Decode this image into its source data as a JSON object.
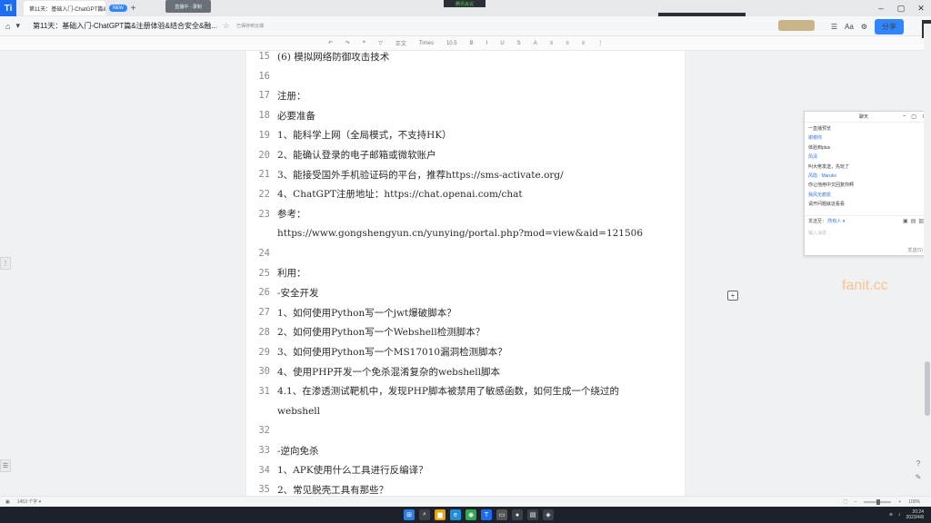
{
  "tabbar": {
    "tab_title": "第11天：基础入门-ChatGPT篇&注册体验&结合安全&融...",
    "tab_badge": "NEW",
    "overlay_text": "直播中 · 录制",
    "meeting_text": "腾讯会议",
    "rec_text": "正在开启 小组会议"
  },
  "titlebar": {
    "doc_title": "第11天：基础入门-ChatGPT篇&注册体验&结合安全&融...",
    "cloud_note": "已保存到云端",
    "share_label": "分享"
  },
  "toolbar": {
    "items": [
      "↶",
      "↷",
      "⌖",
      "▽",
      "正文",
      "Times",
      "10.5",
      "B",
      "I",
      "U",
      "S",
      "A",
      "≡",
      "≡",
      "≡",
      "⋮"
    ]
  },
  "document": {
    "lines": [
      {
        "num": "15",
        "text": "(6) 模拟网络防御攻击技术"
      },
      {
        "num": "16",
        "text": ""
      },
      {
        "num": "17",
        "text": "注册："
      },
      {
        "num": "18",
        "text": "必要准备"
      },
      {
        "num": "19",
        "text": "1、能科学上网（全局模式，不支持HK）"
      },
      {
        "num": "20",
        "text": "2、能确认登录的电子邮箱或微软账户"
      },
      {
        "num": "21",
        "text": "3、能接受国外手机验证码的平台，推荐https://sms-activate.org/"
      },
      {
        "num": "22",
        "text": "4、ChatGPT注册地址：https://chat.openai.com/chat"
      },
      {
        "num": "23",
        "text": "参考："
      },
      {
        "num": "",
        "text": "https://www.gongshengyun.cn/yunying/portal.php?mod=view&aid=121506"
      },
      {
        "num": "24",
        "text": ""
      },
      {
        "num": "25",
        "text": "利用："
      },
      {
        "num": "26",
        "text": "-安全开发"
      },
      {
        "num": "27",
        "text": "1、如何使用Python写一个jwt爆破脚本？"
      },
      {
        "num": "28",
        "text": "2、如何使用Python写一个Webshell检测脚本？"
      },
      {
        "num": "29",
        "text": "3、如何使用Python写一个MS17010漏洞检测脚本？"
      },
      {
        "num": "30",
        "text": "4、使用PHP开发一个免杀混淆复杂的webshell脚本"
      },
      {
        "num": "31",
        "text": "4.1、在渗透测试靶机中，发现PHP脚本被禁用了敏感函数，如何生成一个绕过的"
      },
      {
        "num": "",
        "text": "webshell"
      },
      {
        "num": "32",
        "text": ""
      },
      {
        "num": "33",
        "text": "-逆向免杀"
      },
      {
        "num": "34",
        "text": "1、APK使用什么工具进行反编译？"
      },
      {
        "num": "35",
        "text": "2、常见脱壳工具有那些？"
      }
    ]
  },
  "chat": {
    "title": "聊天",
    "messages": [
      {
        "kind": "first",
        "text": "一直播预览"
      },
      {
        "kind": "user",
        "text": "谢谢你"
      },
      {
        "kind": "text",
        "text": "体验到plus"
      },
      {
        "kind": "user",
        "text": "风清"
      },
      {
        "kind": "text",
        "text": "叫大佬发送，先玩了"
      },
      {
        "kind": "user",
        "text": "风隐 · Maruko"
      },
      {
        "kind": "text",
        "text": "你让他用中文回复你啊"
      },
      {
        "kind": "user",
        "text": "我风无痕凯"
      },
      {
        "kind": "text",
        "text": "请开问题就这看看"
      }
    ],
    "to_label": "发送至：",
    "to_target": "所有人 ▾",
    "input_hint": "输入消息...",
    "send_label": "发送(S)"
  },
  "watermark": "fanit.cc",
  "statusbar": {
    "page_info": "1453 个字 ▾",
    "zoom": "100%"
  },
  "taskbar": {
    "time": "20:24",
    "date": "2023/4/8"
  }
}
